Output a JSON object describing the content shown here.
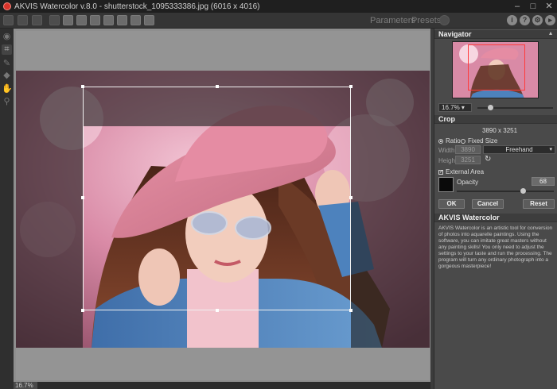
{
  "window": {
    "title": "AKVIS Watercolor v.8.0 - shutterstock_1095333386.jpg (6016 x 4016)",
    "minimize": "–",
    "maximize": "□",
    "close": "✕"
  },
  "toolbar": {
    "tabs": {
      "parameters": "Parameters",
      "presets": "Presets"
    },
    "right_icons": {
      "info": "i",
      "help": "?",
      "settings": "⚙",
      "more": "▸"
    }
  },
  "status": {
    "zoom": "16.7%"
  },
  "navigator": {
    "title": "Navigator",
    "zoom": "16.7% ▾"
  },
  "crop": {
    "title": "Crop",
    "size": "3890 x 3251",
    "ratio_label": "Ratio",
    "fixed_size_label": "Fixed Size",
    "width_label": "Width",
    "width_value": "3890",
    "height_label": "Height",
    "height_value": "3251",
    "mode": "Freehand",
    "external_area_label": "External Area",
    "external_area_checked": "✓",
    "opacity_label": "Opacity",
    "opacity_value": "68",
    "opacity_level": 0.68,
    "ok": "OK",
    "cancel": "Cancel",
    "reset": "Reset"
  },
  "info": {
    "title": "AKVIS Watercolor",
    "text": "AKVIS Watercolor is an artistic tool for conversion of photos into aquarelle paintings. Using the software, you can imitate great masters without any painting skills! You only need to adjust the settings to your taste and run the processing. The program will turn any ordinary photograph into a gorgeous masterpiece!"
  },
  "colors": {
    "accent": "#d9342b",
    "panel_bg": "#4a4a4a",
    "external_color": "#0a0a0a"
  }
}
